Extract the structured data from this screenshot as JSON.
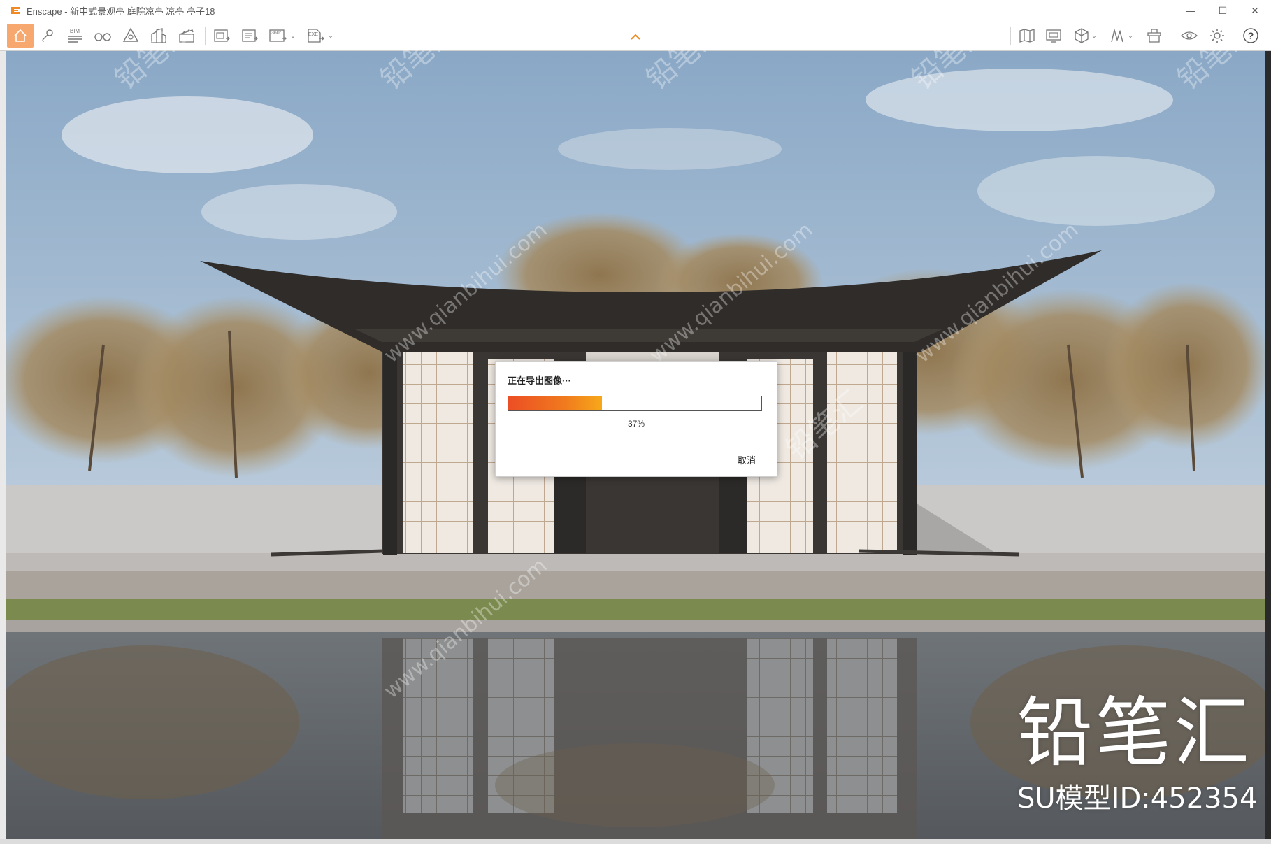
{
  "window": {
    "title": "Enscape - 新中式景观亭 庭院凉亭 凉亭 亭子18",
    "controls": {
      "minimize": "—",
      "maximize": "☐",
      "close": "✕"
    }
  },
  "toolbar": {
    "icons": [
      "home-icon",
      "pin-icon",
      "bim-icon",
      "binoculars-icon",
      "section-icon",
      "buildings-icon",
      "clapper-icon",
      "screenshot-icon",
      "batch-render-icon",
      "panorama-360-icon",
      "export-exe-icon",
      "map-icon",
      "monitor-icon",
      "cube-icon",
      "sketch-icon",
      "asset-icon",
      "visibility-icon",
      "gear-icon",
      "help-icon"
    ],
    "bim_label": "BIM",
    "pano_label": "360°",
    "exe_label": "EXE",
    "help_label": "?"
  },
  "dialog": {
    "title": "正在导出图像···",
    "progress": 0.37,
    "progress_label": "37%",
    "cancel_label": "取消"
  },
  "brand": {
    "name": "铅笔汇",
    "model_id": "SU模型ID:452354"
  },
  "watermark": {
    "text_cn": "铅笔汇",
    "text_url": "www.qianbihui.com"
  },
  "colors": {
    "accent": "#f08a24",
    "progress_start": "#ec4e24",
    "progress_end": "#f7a81a",
    "home_active": "#f6a86e"
  }
}
